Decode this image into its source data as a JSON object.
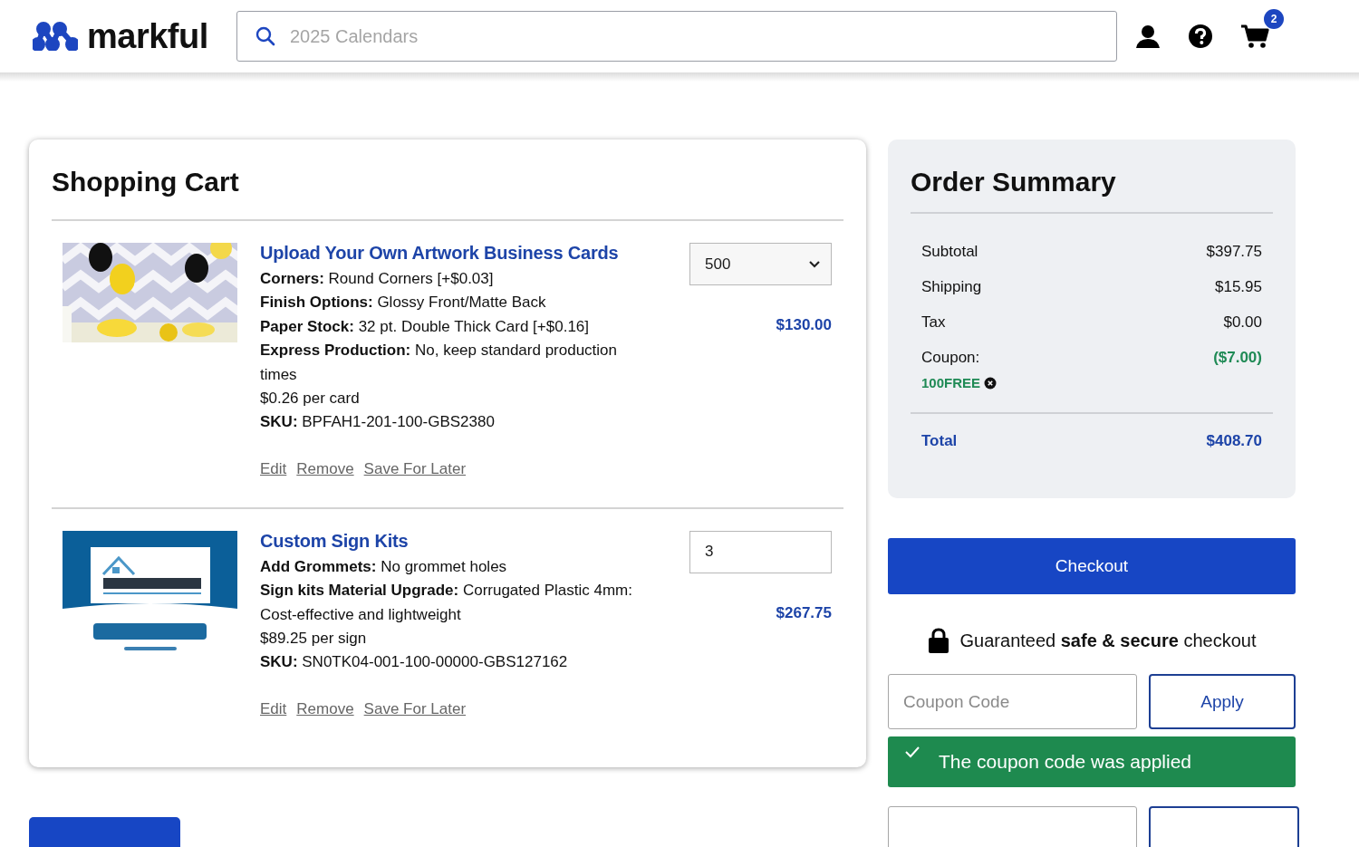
{
  "header": {
    "logo": "markful",
    "search": {
      "placeholder": "2025 Calendars"
    },
    "cart_count": "2"
  },
  "cart": {
    "title": "Shopping Cart",
    "items": [
      {
        "image": {
          "kind": "picture"
        },
        "name": "Upload Your Own Artwork Business Cards",
        "options": [
          {
            "label": "Corners:",
            "value": "Round Corners [+$0.03]"
          },
          {
            "label": "Finish Options:",
            "value": "Glossy Front/Matte Back"
          },
          {
            "label": "Paper Stock:",
            "value": "32 pt. Double Thick Card [+$0.16]"
          },
          {
            "label": "Express Production:",
            "value": "No, keep standard production times"
          }
        ],
        "unit_price": "$0.26 per card",
        "sku": {
          "label": "SKU:",
          "value": "BPFAH1-201-100-GBS2380"
        },
        "quantity": {
          "kind": "select",
          "value": "500"
        },
        "price": "$130.00",
        "actions": [
          "Edit",
          "Remove",
          "Save For Later"
        ]
      },
      {
        "image": {
          "kind": "picture"
        },
        "name": "Custom Sign Kits",
        "options": [
          {
            "label": "Add Grommets:",
            "value": "No grommet holes"
          },
          {
            "label": "Sign kits Material Upgrade:",
            "value": "Corrugated Plastic 4mm: Cost-effective and lightweight"
          }
        ],
        "unit_price": "$89.25 per sign",
        "sku": {
          "label": "SKU:",
          "value": "SN0TK04-001-100-00000-GBS127162"
        },
        "quantity": {
          "kind": "input",
          "value": "3"
        },
        "price": "$267.75",
        "actions": [
          "Edit",
          "Remove",
          "Save For Later"
        ]
      }
    ]
  },
  "summary": {
    "title": "Order Summary",
    "rows": [
      {
        "label": "Subtotal",
        "value": "$397.75",
        "kind": "normal"
      },
      {
        "label": "Shipping",
        "value": "$15.95",
        "kind": "normal"
      },
      {
        "label": "Tax",
        "value": "$0.00",
        "kind": "normal"
      },
      {
        "label": "Coupon:",
        "value": "($7.00)",
        "kind": "discount"
      }
    ],
    "coupon_tag": "100FREE",
    "total": {
      "label": "Total",
      "value": "$408.70"
    }
  },
  "checkout_button": "Checkout",
  "secure_note": "Guaranteed **safe & secure** checkout",
  "coupon": {
    "placeholder": "Coupon Code",
    "button": "Apply"
  },
  "alert": {
    "text": "The coupon code was applied"
  }
}
